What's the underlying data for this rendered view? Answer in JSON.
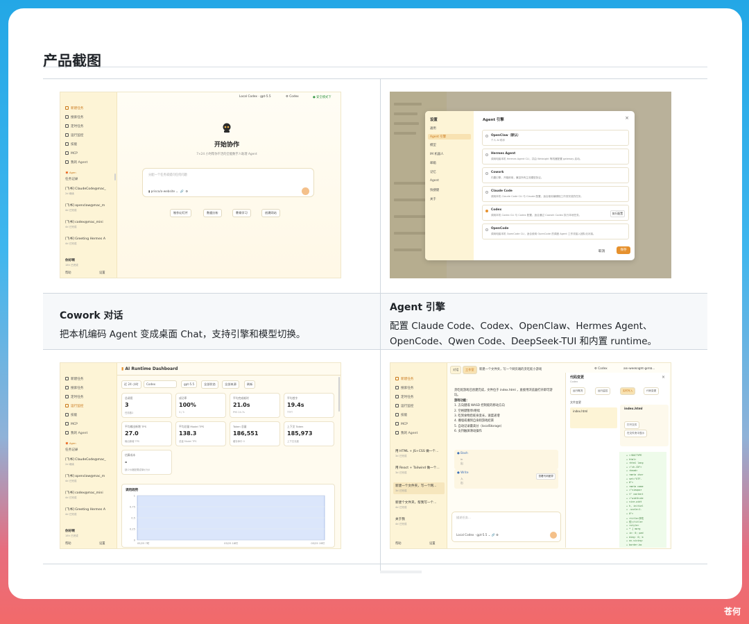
{
  "page": {
    "title": "产品截图",
    "watermark": "苍何",
    "colors": {
      "accent": "#e6912e",
      "sidebar": "#fdf4d6",
      "brand_bg": "#3fb6ee"
    }
  },
  "captions": [
    {
      "title": "Cowork 对话",
      "desc": "把本机编码 Agent 变成桌面 Chat，支持引擎和模型切换。"
    },
    {
      "title": "Agent 引擎",
      "desc": "配置 Claude Code、Codex、OpenClaw、Hermes Agent、OpenCode、Qwen Code、DeepSeek-TUI 和内置 runtime。"
    }
  ],
  "sidebar": {
    "items": [
      "新建任务",
      "搜索任务",
      "定时任务",
      "运行监控",
      "技能",
      "MCP",
      "我的 Agent"
    ],
    "history_label": "任务记录",
    "brand": "Agen",
    "sessions": [
      {
        "title": "[飞书] ClaudeCode@mac_",
        "meta": "2d 继续"
      },
      {
        "title": "[飞书] openclaw@mac_m",
        "meta": "4d 已完成"
      },
      {
        "title": "[飞书] codex@mac_mini",
        "meta": "4d 已完成"
      },
      {
        "title": "[飞书] Greeting Hermes A",
        "meta": "4d 已完成"
      }
    ],
    "user_name": "你好啊",
    "user_meta": "18h 已完成",
    "help": "帮助",
    "settings": "设置"
  },
  "shot1": {
    "model_select": "Local Codex · gpt-5.5",
    "engine_select": "Codex",
    "status": "● 安全模式下",
    "title": "开始协作",
    "subtitle": "7×24 小时帮你干活的全能数字人助理 Agent",
    "input_placeholder": "分配一个任务或提问任何问题",
    "folder": "prisco/o-website",
    "chips": [
      "制作幻灯片",
      "数据分析",
      "教育学习",
      "创建网站"
    ]
  },
  "shot2": {
    "settings_title": "设置",
    "nav": [
      "通用",
      "Agent 引擎",
      "模型",
      "IM 机器人",
      "邮箱",
      "记忆",
      "Agent",
      "快捷键",
      "关于"
    ],
    "panel_title": "Agent 引擎",
    "close": "×",
    "options": [
      {
        "name": "OpenClaw（默认）",
        "desc": "个人 AI 助手",
        "selected": false
      },
      {
        "name": "Hermes Agent",
        "desc": "调用电脑本机 Hermes Agent CLI，并由 Websight 等机器配置 gateway 启动。",
        "selected": false
      },
      {
        "name": "Cowork",
        "desc": "内置引擎，开箱即用，兼容所有主流模型协议。",
        "selected": false
      },
      {
        "name": "Claude Code",
        "desc": "调用本机 Claude Code CLI 与 Claude 配置，适合使用编辑相工作流完成的任务。",
        "selected": false
      },
      {
        "name": "Codex",
        "desc": "调用本机 Codex CLI 与 Codex 配置，适合通过 Cowork Codex 执行本地任务。",
        "selected": true,
        "config": "执行配置"
      },
      {
        "name": "OpenCode",
        "desc": "调用电脑本机 OpenCode CLI，适合使用 OpenCode 的调度 Agent 工作流接入团队化对接。",
        "selected": false
      }
    ],
    "cancel": "取消",
    "save": "保存"
  },
  "shot3": {
    "title": "AI Runtime Dashboard",
    "filters": [
      "近 24 小时",
      "Codex",
      "gpt-5.5",
      "全部状态",
      "全部来源",
      "刷新"
    ],
    "stats": [
      {
        "label": "总调用",
        "value": "3",
        "sub": "任务数2"
      },
      {
        "label": "成功率",
        "value": "100%",
        "sub": "3 / 3"
      },
      {
        "label": "平均完成耗时",
        "value": "21.0s",
        "sub": "P95 24.7s"
      },
      {
        "label": "平均首字",
        "value": "19.4s",
        "sub": "TTFT"
      },
      {
        "label": "平均输出新增 TPS",
        "value": "27.0",
        "sub": "输出新增 TPS"
      },
      {
        "label": "平均总量 Model TPS",
        "value": "138.3",
        "sub": "总量 Model TPS"
      },
      {
        "label": "Token 总量",
        "value": "186,551",
        "sub": "缓存命中 0"
      },
      {
        "label": "上下文 Token",
        "value": "185,973",
        "sub": "上下文长度"
      },
      {
        "label": "估算成本",
        "value": "-",
        "sub": "缺少价格配置或单价为0"
      }
    ],
    "trend_title": "调用趋势"
  },
  "shot4": {
    "tabs": [
      "对话",
      "工作室"
    ],
    "chat_title": "新建一个文件夹，写一个网页端的贪吃蛇小游戏",
    "engine": "Codex",
    "workspace": "ani-weeklight-gimb...",
    "message": "贪吃蛇游戏已创建完成，文件位于 index.html ，直接用浏览器打开即可游玩。",
    "features_label": "游戏功能：",
    "features": [
      "方向键或 WASD 控制蛇的移动方向",
      "空格键暂停/继续",
      "吃到食物后蛇身变长，速度递增",
      "撞墙或撞到自身则游戏结束",
      "自动记录最高分（localStorage）",
      "支持触屏滑动操作"
    ],
    "tool1": "Bash",
    "tool2": "Write",
    "open_code": "查看代码差异",
    "input_placeholder": "描述任务…",
    "model": "Local Codex · gpt-5.5",
    "panel_title": "代码变更",
    "panel_sub": "Codex",
    "panel_tabs": [
      "运行概况",
      "运行监控",
      "实时写入",
      "代码变更"
    ],
    "file": "index.html",
    "file_changes": "文件变更",
    "open_file": "打开文件",
    "open_in": "在文件夹中显示",
    "sessions": [
      {
        "title": "用 HTML + JS+CSS 做一个...",
        "meta": "3d 已完成"
      },
      {
        "title": "用 React + Tailwind 做一个...",
        "meta": "3d 已完成"
      },
      {
        "title": "新建一个文件夹，写一个网...",
        "meta": "3d 已完成"
      },
      {
        "title": "新建个文件夹，帮我写一个...",
        "meta": "4d 已完成"
      },
      {
        "title": "关于我",
        "meta": "4d 已完成"
      }
    ]
  },
  "chart_data": {
    "type": "area",
    "title": "调用趋势",
    "x": [
      "05/25 7时",
      "05/25 18时",
      "05/25 19时"
    ],
    "yticks": [
      0,
      0.25,
      0.5,
      0.75,
      1
    ],
    "ylim": [
      0,
      1
    ],
    "series": [
      {
        "values": [
          1,
          1,
          1
        ]
      }
    ]
  }
}
